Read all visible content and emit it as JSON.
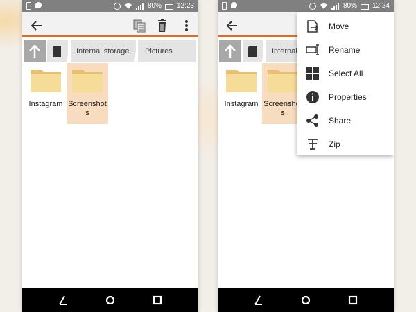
{
  "status_bar": {
    "battery_left": "80%",
    "time_left": "12:23",
    "battery_right": "80%",
    "time_right": "12:24"
  },
  "breadcrumb": {
    "segments": [
      "Internal storage",
      "Pictures"
    ]
  },
  "folders": [
    {
      "label": "Instagram",
      "selected": false
    },
    {
      "label": "Screenshots",
      "selected": true
    }
  ],
  "menu": {
    "items": [
      {
        "label": "Move",
        "icon": "move-icon"
      },
      {
        "label": "Rename",
        "icon": "rename-icon"
      },
      {
        "label": "Select All",
        "icon": "select-all-icon"
      },
      {
        "label": "Properties",
        "icon": "properties-icon"
      },
      {
        "label": "Share",
        "icon": "share-icon"
      },
      {
        "label": "Zip",
        "icon": "zip-icon"
      }
    ]
  },
  "colors": {
    "accent": "#e06c1e",
    "selection": "#f7dcc0",
    "folder": "#f3d78e",
    "status_bar": "#808080",
    "nav_bar": "#000000"
  }
}
